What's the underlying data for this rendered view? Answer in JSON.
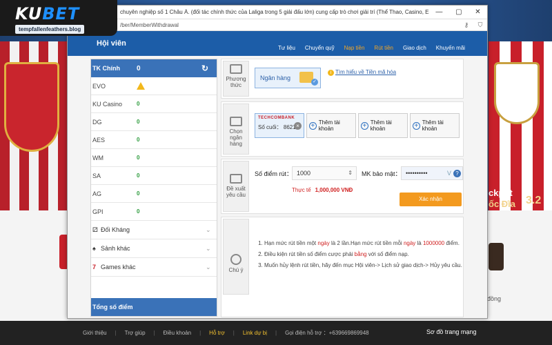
{
  "logo": {
    "brand_a": "KU",
    "brand_b": "BET",
    "url": "tempfallenfeathers.blog"
  },
  "window": {
    "title": "chuyên nghiệp số 1 Châu Á. (đối tác chính thức của Laliga trong 5 giải đấu lớn) cung cấp trò chơi giải trí (Thể Thao, Casino, E-Sports,...",
    "address": "/ber/MemberWithdrawal",
    "controls": [
      "—",
      "▢",
      "✕"
    ]
  },
  "header": {
    "title": "Hội viên",
    "nav": [
      "Tư liệu",
      "Chuyển quỹ",
      "Nạp tiền",
      "Rút tiền",
      "Giao dịch",
      "Khuyến mãi"
    ]
  },
  "left_panel": {
    "main": {
      "label": "TK Chính",
      "value": "0"
    },
    "items": [
      {
        "label": "EVO",
        "value": ""
      },
      {
        "label": "KU Casino",
        "value": "0"
      },
      {
        "label": "DG",
        "value": "0"
      },
      {
        "label": "AES",
        "value": "0"
      },
      {
        "label": "WM",
        "value": "0"
      },
      {
        "label": "SA",
        "value": "0"
      },
      {
        "label": "AG",
        "value": "0"
      },
      {
        "label": "GPI",
        "value": "0"
      }
    ],
    "categories": [
      "Đối Kháng",
      "Sảnh khác",
      "Games khác"
    ],
    "total_label": "Tổng số điểm"
  },
  "payment": {
    "icon_label": "Phương thức",
    "bank_button": "Ngân hàng",
    "info_link": "Tìm hiểu về Tiền mã hóa"
  },
  "bank_select": {
    "icon_label": "Chọn ngân hàng",
    "selected": {
      "brand": "TECHCOMBANK",
      "number": "Số cuối： 8621"
    },
    "add_label": "Thêm tài khoản"
  },
  "withdraw_form": {
    "icon_label": "Đề xuất yêu cầu",
    "points_label": "Số điểm rút：",
    "points_value": "1000",
    "pwd_label": "MK bảo mật：",
    "pwd_value": "••••••••••",
    "actual_label": "Thực tế",
    "actual_value": "1,000,000 VNĐ",
    "confirm": "Xác nhận"
  },
  "notes": {
    "icon_label": "Chú ý",
    "n1_a": "Hạn mức rút tiền một ",
    "n1_b": "ngày",
    "n1_c": " là 2 lần.Hạn mức rút tiền mỗi ",
    "n1_d": "ngày",
    "n1_e": " là ",
    "n1_f": "1000000",
    "n1_g": " điểm.",
    "n2_a": "Điều kiện rút tiền số điểm cược phải ",
    "n2_b": "bằng",
    "n2_c": " với số điểm nạp.",
    "n3": "Muốn hủy lệnh rút tiền, hãy đến mục Hội viên-> Lịch sử giao dịch-> Hủy yêu cầu."
  },
  "background": {
    "jackpot1": "ckpot",
    "jackpot2": "ốc Đĩa",
    "amount": "3.2",
    "dong": "đồng"
  },
  "footer": {
    "items": [
      "Giới thiệu",
      "Trợ giúp",
      "Điều khoản",
      "Hỗ trợ",
      "Link dự bị",
      "Gọi điện hỗ trợ ：+639669869948"
    ],
    "right": "Sơ đồ trang mạng"
  }
}
